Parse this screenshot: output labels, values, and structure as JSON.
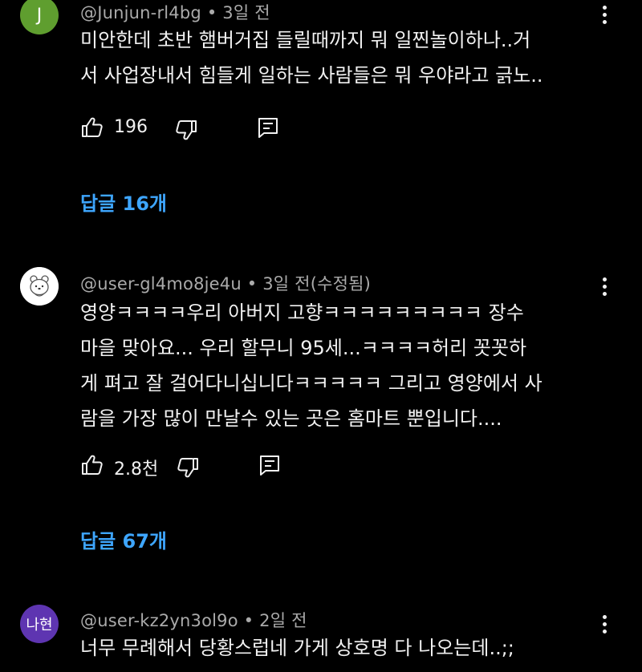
{
  "colors": {
    "background": "#000000",
    "text": "#f1f1f1",
    "meta": "#aaaaaa",
    "link": "#3ea6ff"
  },
  "comments": [
    {
      "avatar_letter": "J",
      "avatar_color": "#5f9e2f",
      "handle": "@Junjun-rl4bg",
      "time": "3일 전",
      "text_lines": [
        "미안한데 초반 햄버거집 들릴때까지 뭐 일찐놀이하나..거",
        "서 사업장내서 힘들게 일하는 사람들은 뭐 우야라고 긁노.."
      ],
      "likes": "196",
      "replies": "답글 16개",
      "more_icon": "more-vert-icon",
      "like_icon": "thumb-up-icon",
      "dislike_icon": "thumb-down-icon",
      "reply_icon": "reply-icon"
    },
    {
      "avatar_image": "bear-avatar",
      "avatar_color": "#ffffff",
      "handle": "@user-gl4mo8je4u",
      "time": "3일 전(수정됨)",
      "text_lines": [
        "영양ㅋㅋㅋㅋ우리 아버지 고향ㅋㅋㅋㅋㅋㅋㅋㅋㅋ 장수",
        "마을 맞아요... 우리 할무니 95세...ㅋㅋㅋㅋ허리 꼿꼿하",
        "게 펴고 잘 걸어다니십니다ㅋㅋㅋㅋㅋ 그리고 영양에서 사",
        "람을 가장 많이 만날수 있는 곳은 홈마트 뿐입니다...."
      ],
      "likes": "2.8천",
      "replies": "답글 67개",
      "more_icon": "more-vert-icon",
      "like_icon": "thumb-up-icon",
      "dislike_icon": "thumb-down-icon",
      "reply_icon": "reply-icon"
    },
    {
      "avatar_text": "나현",
      "avatar_color": "#5e35b1",
      "handle": "@user-kz2yn3ol9o",
      "time": "2일 전",
      "text_lines": [
        "너무 무례해서 당황스럽네 가게 상호명 다 나오는데..;;"
      ],
      "more_icon": "more-vert-icon"
    }
  ]
}
